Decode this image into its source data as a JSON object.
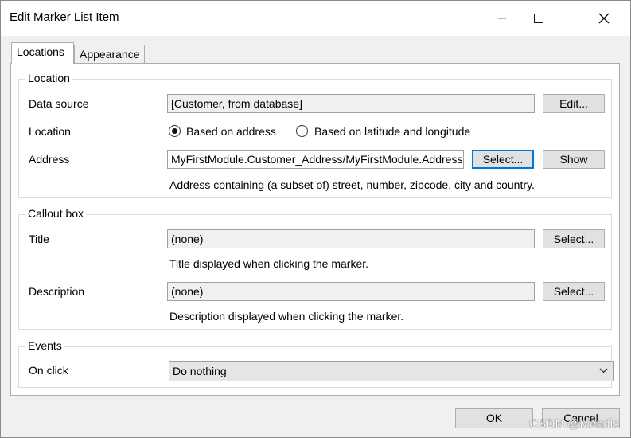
{
  "window": {
    "title": "Edit Marker List Item"
  },
  "tabs": [
    {
      "label": "Locations",
      "active": true
    },
    {
      "label": "Appearance",
      "active": false
    }
  ],
  "location_group": {
    "legend": "Location",
    "data_source": {
      "label": "Data source",
      "value": "[Customer, from database]",
      "edit_label": "Edit..."
    },
    "location": {
      "label": "Location",
      "option_address": "Based on address",
      "option_latlong": "Based on latitude and longitude",
      "selected": "address"
    },
    "address": {
      "label": "Address",
      "value": "MyFirstModule.Customer_Address/MyFirstModule.Address",
      "select_label": "Select...",
      "show_label": "Show",
      "hint": "Address containing (a subset of) street, number, zipcode, city and country."
    }
  },
  "callout_group": {
    "legend": "Callout box",
    "title": {
      "label": "Title",
      "value": "(none)",
      "select_label": "Select...",
      "hint": "Title displayed when clicking the marker."
    },
    "description": {
      "label": "Description",
      "value": "(none)",
      "select_label": "Select...",
      "hint": "Description displayed when clicking the marker."
    }
  },
  "events_group": {
    "legend": "Events",
    "on_click": {
      "label": "On click",
      "value": "Do nothing"
    }
  },
  "footer": {
    "ok_label": "OK",
    "cancel_label": "Cancel"
  },
  "watermark": "CSDN @Mendix",
  "colors": {
    "focus_border": "#0078d7",
    "panel_bg": "#ffffff",
    "window_bg": "#f0f0f0"
  }
}
